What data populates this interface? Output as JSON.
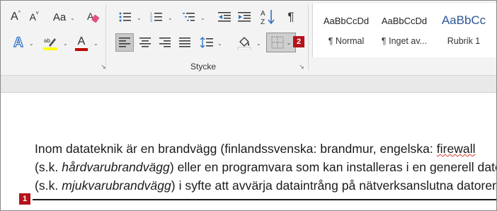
{
  "ribbon": {
    "font_group": {
      "grow_font": "A",
      "shrink_font": "A",
      "change_case": "Aa",
      "text_effects": "A",
      "font_color": "A",
      "font_color_bar": "#c00000",
      "highlight_bar": "#ffff00"
    },
    "paragraph_group": {
      "label": "Stycke",
      "sort": "A↓Z",
      "pilcrow": "¶"
    },
    "styles_gallery": [
      {
        "sample": "AaBbCcDd",
        "name": "¶ Normal"
      },
      {
        "sample": "AaBbCcDd",
        "name": "¶ Inget av..."
      },
      {
        "sample": "AaBbCc",
        "name": "Rubrik 1"
      }
    ]
  },
  "badges": {
    "borders_badge": "2",
    "paragraph_badge": "1"
  },
  "document": {
    "line1_a": "Inom datateknik är en brandvägg (finlandssvenska: brandmur, engelska: ",
    "line1_b": "firewall",
    "line2_a": "(s.k. ",
    "line2_b": "hårdvarubrandvägg",
    "line2_c": ") eller en programvara som kan installeras i en generell dator",
    "line3_a": "(s.k. ",
    "line3_b": "mjukvarubrandvägg",
    "line3_c": ") i syfte att avvärja dataintrång på nätverksanslutna datorer."
  }
}
